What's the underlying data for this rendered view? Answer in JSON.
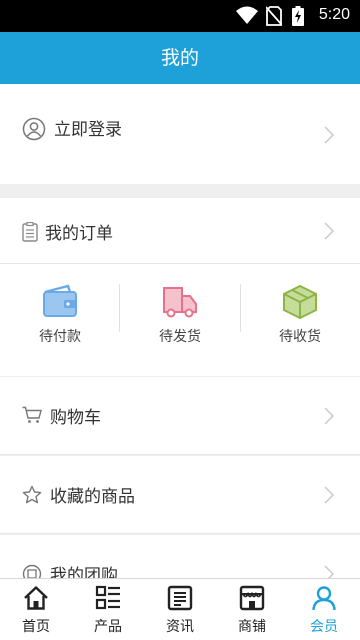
{
  "status_bar": {
    "time": "5:20"
  },
  "header": {
    "title": "我的"
  },
  "login": {
    "label": "立即登录"
  },
  "orders": {
    "title": "我的订单",
    "statuses": [
      {
        "label": "待付款",
        "icon": "wallet-icon",
        "color": "#6aa9e8"
      },
      {
        "label": "待发货",
        "icon": "truck-icon",
        "color": "#ea6f8a"
      },
      {
        "label": "待收货",
        "icon": "package-box-icon",
        "color": "#8db545"
      }
    ]
  },
  "menu": [
    {
      "label": "购物车",
      "icon": "cart-icon"
    },
    {
      "label": "收藏的商品",
      "icon": "star-icon"
    },
    {
      "label": "我的团购",
      "icon": "group-buy-icon"
    }
  ],
  "tabbar": {
    "active_color": "#1ea1d8",
    "tabs": [
      {
        "label": "首页",
        "icon": "home-icon"
      },
      {
        "label": "产品",
        "icon": "product-list-icon"
      },
      {
        "label": "资讯",
        "icon": "news-icon"
      },
      {
        "label": "商铺",
        "icon": "shop-icon"
      },
      {
        "label": "会员",
        "icon": "member-icon",
        "active": true
      }
    ]
  }
}
